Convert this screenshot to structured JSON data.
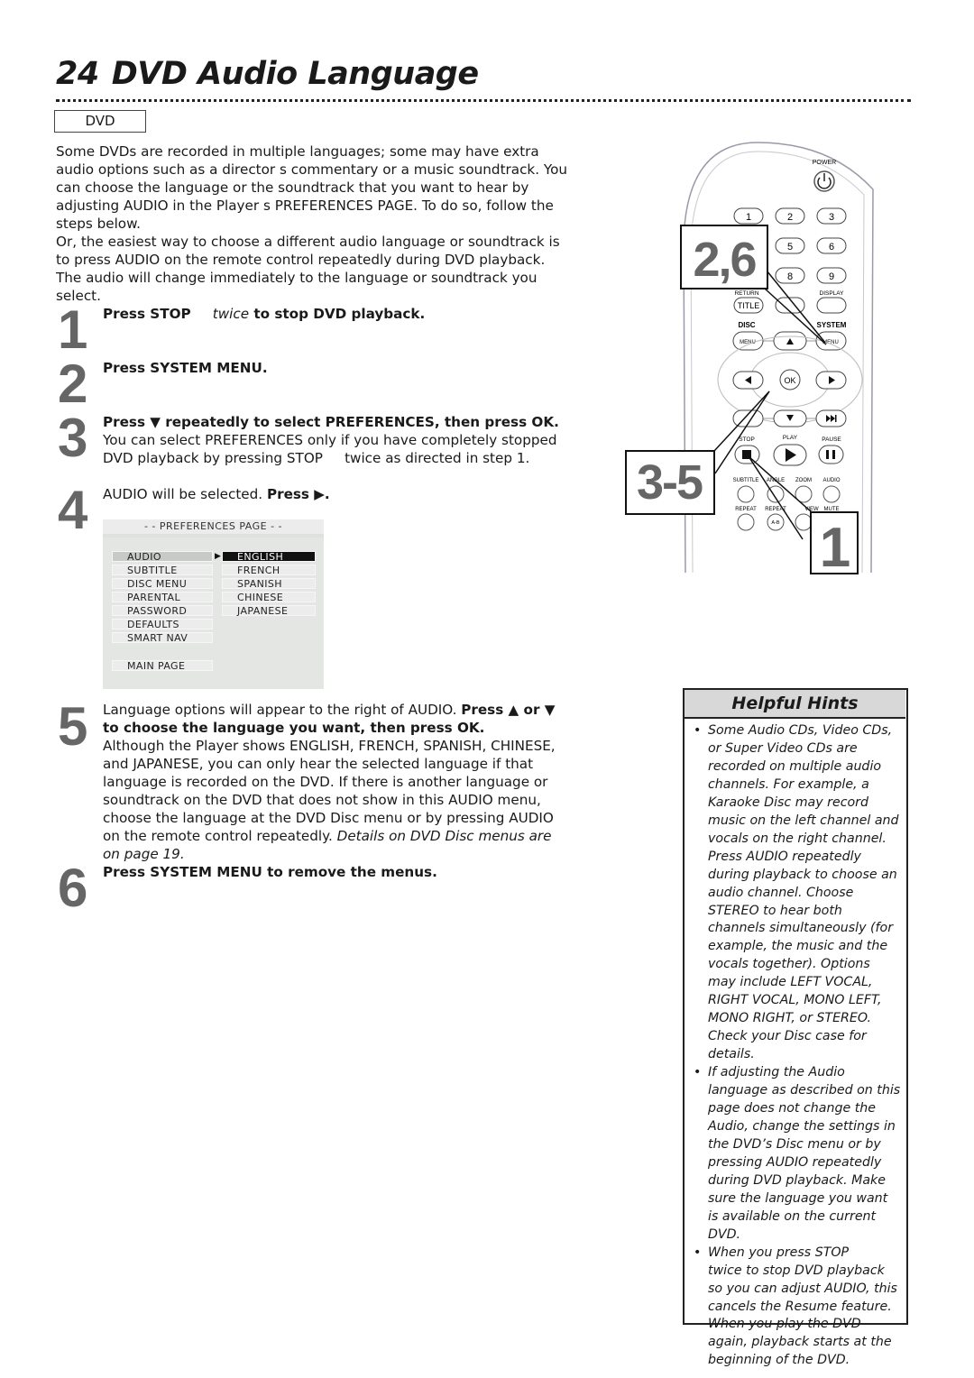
{
  "page": {
    "number": "24",
    "title": "DVD Audio Language",
    "badge": "DVD"
  },
  "intro": {
    "p1": "Some DVDs are recorded in multiple languages; some may have extra audio options such as a director s commentary or a music soundtrack. You can choose the language or the soundtrack that you want to hear by adjusting AUDIO in the Player s PREFERENCES PAGE. To do so, follow the steps below.",
    "p2": "Or, the easiest way to choose a different audio language or soundtrack is to press AUDIO on the remote control repeatedly during DVD playback. The audio will change immediately to the language or soundtrack you select."
  },
  "steps": [
    {
      "num": "1",
      "bold_a": "Press STOP",
      "italic": "twice",
      "bold_b": " to stop DVD playback."
    },
    {
      "num": "2",
      "bold": "Press SYSTEM MENU."
    },
    {
      "num": "3",
      "bold": "Press ▼ repeatedly to select PREFERENCES, then press OK.",
      "text": "You can select PREFERENCES only if you have completely stopped DVD playback by pressing STOP     twice as directed in step 1."
    },
    {
      "num": "4",
      "text": "AUDIO will be selected. ",
      "bold": "Press ▶."
    },
    {
      "num": "5",
      "text_a": "Language options will appear to the right of AUDIO. ",
      "bold": "Press ▲ or ▼ to choose the language you want, then press OK.",
      "text_b": "Although the Player shows ENGLISH, FRENCH, SPANISH, CHINESE, and JAPANESE, you can only hear the selected language if that language is recorded on the DVD. If there is another language or soundtrack on the DVD that does not show in this AUDIO menu, choose the language at the DVD Disc menu or by pressing AUDIO on the remote control repeatedly. ",
      "italic": "Details on DVD Disc menus are on page 19."
    },
    {
      "num": "6",
      "bold": "Press SYSTEM MENU to remove the menus."
    }
  ],
  "preferences_menu": {
    "title": "- -  PREFERENCES PAGE  - -",
    "items": [
      "AUDIO",
      "SUBTITLE",
      "DISC MENU",
      "PARENTAL",
      "PASSWORD",
      "DEFAULTS",
      "SMART NAV"
    ],
    "selected_item": "AUDIO",
    "main_page": "MAIN PAGE",
    "languages": [
      "ENGLISH",
      "FRENCH",
      "SPANISH",
      "CHINESE",
      "JAPANESE"
    ],
    "selected_language": "ENGLISH"
  },
  "remote": {
    "power": "POWER",
    "digits": [
      "1",
      "2",
      "3",
      "5",
      "6",
      "8",
      "9"
    ],
    "return_label": "RETURN",
    "title_btn": "TITLE",
    "display_label": "DISPLAY",
    "disc_label": "DISC",
    "system_label": "SYSTEM",
    "menu_btn": "MENU",
    "ok_btn": "OK",
    "stop_label": "STOP",
    "play_label": "PLAY",
    "pause_label": "PAUSE",
    "subtitle_label": "SUBTITLE",
    "angle_label": "ANGLE",
    "zoom_label": "ZOOM",
    "audio_label": "AUDIO",
    "repeat_label": "REPEAT",
    "repeat_ab_label": "REPEAT",
    "ab_btn": "A-B",
    "preview_label": "VIEW",
    "mute_label": "MUTE",
    "callouts": [
      "2,6",
      "3-5",
      "1"
    ]
  },
  "hints": {
    "title": "Helpful Hints",
    "items": [
      "Some Audio CDs, Video CDs, or Super Video CDs are recorded on multiple audio channels. For example, a Karaoke Disc may record music on the left channel and vocals on the right channel. Press AUDIO repeatedly during playback to choose an audio channel. Choose STEREO to hear both channels simultaneously (for example, the music and the vocals together). Options may include LEFT VOCAL, RIGHT VOCAL, MONO LEFT, MONO RIGHT, or STEREO. Check your Disc case for details.",
      "If adjusting the Audio language as described on this page does not change the Audio, change the settings in the DVD’s Disc menu or by pressing AUDIO repeatedly during DVD playback. Make sure the language you want is available on the current DVD.",
      "When you press STOP     twice to stop DVD playback so you can adjust AUDIO, this cancels the Resume feature. When you play the DVD again, playback starts at the beginning of the DVD."
    ]
  }
}
